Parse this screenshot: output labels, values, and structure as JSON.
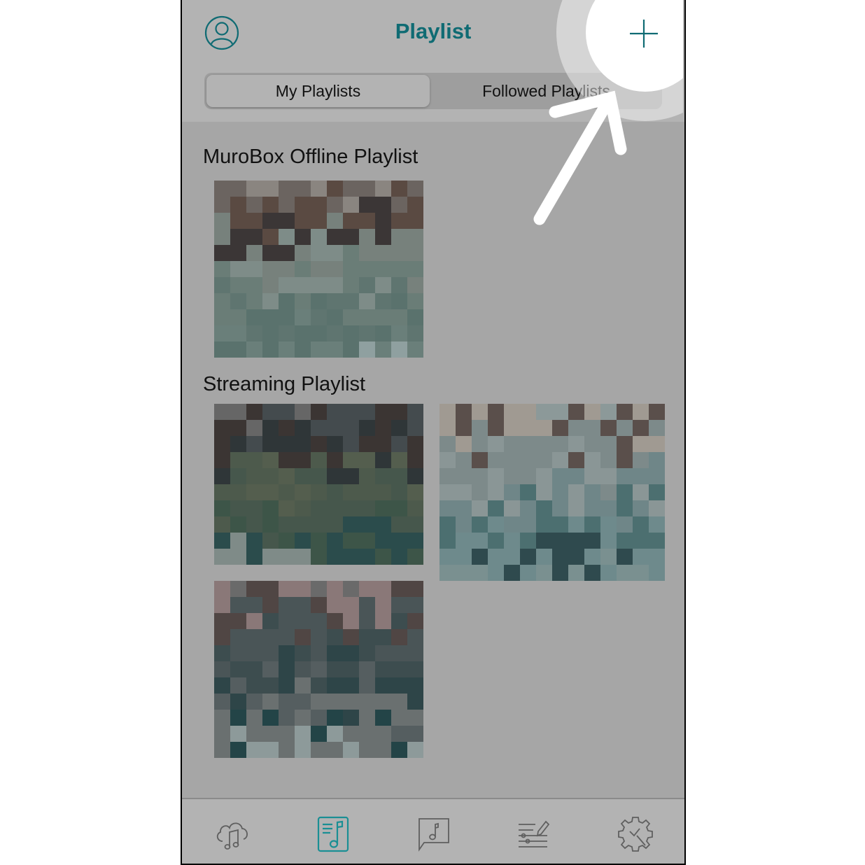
{
  "header": {
    "title": "Playlist",
    "profile_icon": "person-circle-icon",
    "add_icon": "plus-icon"
  },
  "segments": [
    {
      "label": "My Playlists",
      "selected": true
    },
    {
      "label": "Followed Playlists",
      "selected": false
    }
  ],
  "sections": [
    {
      "title": "MuroBox Offline Playlist",
      "thumbnails": 1
    },
    {
      "title": "Streaming Playlist",
      "thumbnails": 3
    }
  ],
  "tabbar": {
    "items": [
      {
        "icon": "cloud-music-icon",
        "active": false
      },
      {
        "icon": "playlist-document-icon",
        "active": true
      },
      {
        "icon": "music-message-icon",
        "active": false
      },
      {
        "icon": "equalizer-edit-icon",
        "active": false
      },
      {
        "icon": "settings-wrench-icon",
        "active": false
      }
    ]
  },
  "colors": {
    "accent": "#0f6b73",
    "active_tab": "#1a8f94",
    "inactive_icon": "#5a5a5a"
  },
  "annotation": {
    "highlight_target": "add-playlist-button",
    "arrow": "pointing to add button"
  }
}
